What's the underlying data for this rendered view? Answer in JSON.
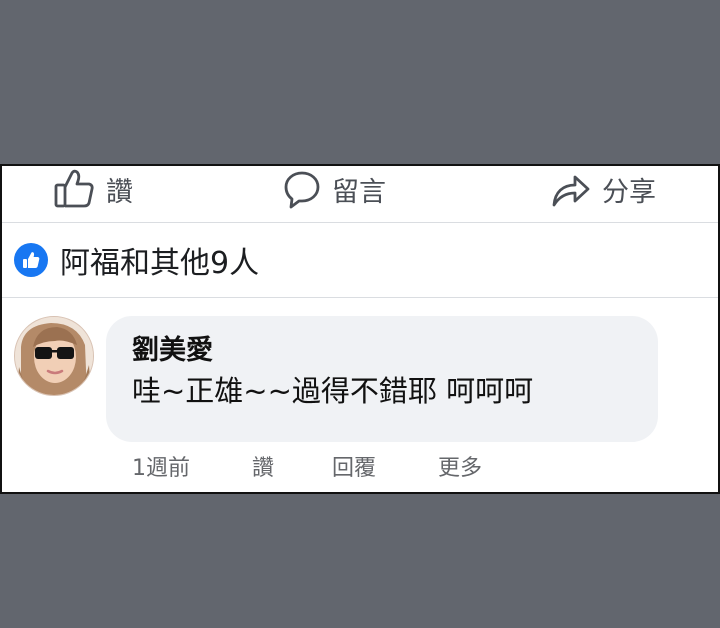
{
  "actions": {
    "like_label": "讚",
    "comment_label": "留言",
    "share_label": "分享"
  },
  "icons": {
    "like": "thumbs-up-icon",
    "comment": "speech-bubble-icon",
    "share": "share-arrow-icon",
    "reaction": "like-reaction-icon",
    "avatar": "user-avatar"
  },
  "reactions": {
    "summary": "阿福和其他9人"
  },
  "comment": {
    "author": "劉美愛",
    "text": "哇~正雄~~過得不錯耶 呵呵呵",
    "time": "1週前",
    "like_label": "讚",
    "reply_label": "回覆",
    "more_label": "更多"
  },
  "colors": {
    "background": "#62666e",
    "panel": "#ffffff",
    "bubble": "#f0f2f5",
    "like_blue": "#1877f2",
    "secondary_text": "#65676b"
  }
}
